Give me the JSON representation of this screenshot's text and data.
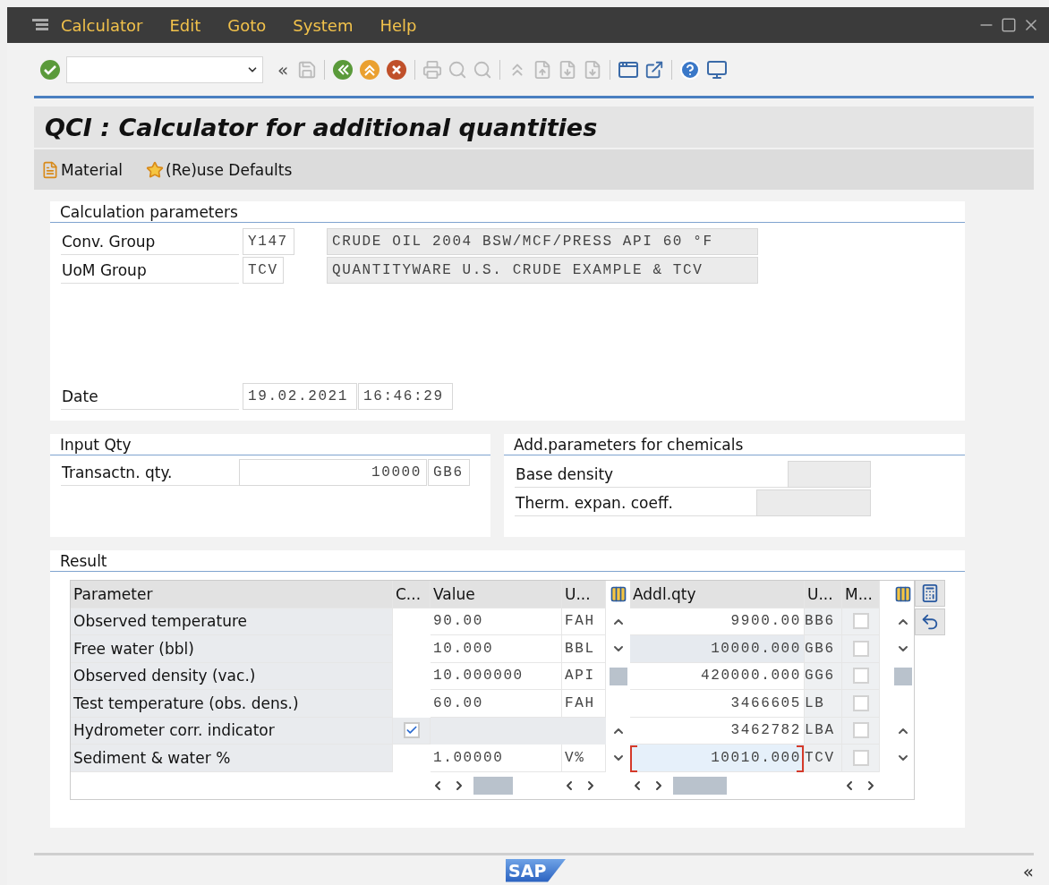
{
  "menu_bar": {
    "items": [
      "Calculator",
      "Edit",
      "Goto",
      "System",
      "Help"
    ]
  },
  "toolbar": {
    "collapse_glyph": "«"
  },
  "title": "QCI : Calculator for additional quantities",
  "app_toolbar": [
    {
      "label": "Material",
      "kind": "material"
    },
    {
      "label": "(Re)use Defaults",
      "kind": "defaults"
    }
  ],
  "calculation_parameters": {
    "title": "Calculation parameters",
    "fields": [
      {
        "label": "Conv. Group",
        "value": "Y147",
        "description": "CRUDE OIL 2004 BSW/MCF/PRESS API 60 °F"
      },
      {
        "label": "UoM Group",
        "value": "TCV",
        "description": "QUANTITYWARE U.S. CRUDE EXAMPLE & TCV"
      }
    ],
    "date": {
      "label": "Date",
      "date": "19.02.2021",
      "time": "16:46:29"
    }
  },
  "input_qty": {
    "title": "Input Qty",
    "label": "Transactn. qty.",
    "value": "10000",
    "unit": "GB6"
  },
  "chemicals": {
    "title": "Add.parameters for chemicals",
    "fields": [
      {
        "label": "Base density"
      },
      {
        "label": "Therm. expan. coeff."
      }
    ]
  },
  "result": {
    "title": "Result",
    "parameters": {
      "columns": [
        "Parameter",
        "C...",
        "Value",
        "U..."
      ],
      "rows": [
        {
          "kind": "value",
          "parameter": "Observed temperature",
          "value": "90.00",
          "unit": "FAH"
        },
        {
          "kind": "value",
          "parameter": "Free water (bbl)",
          "value": "10.000",
          "unit": "BBL"
        },
        {
          "kind": "value",
          "parameter": "Observed density (vac.)",
          "value": "10.000000",
          "unit": "API"
        },
        {
          "kind": "value",
          "parameter": "Test temperature (obs. dens.)",
          "value": "60.00",
          "unit": "FAH"
        },
        {
          "kind": "flag",
          "parameter": "Hydrometer corr. indicator",
          "checked": true
        },
        {
          "kind": "value",
          "parameter": "Sediment & water %",
          "value": "1.00000",
          "unit": "V%"
        }
      ]
    },
    "quantities": {
      "columns": [
        "Addl.qty",
        "U...",
        "M..."
      ],
      "rows": [
        {
          "qty": "9900.00",
          "unit": "BB6",
          "checked": false,
          "highlighted": false,
          "focused": false
        },
        {
          "qty": "10000.000",
          "unit": "GB6",
          "checked": false,
          "highlighted": true,
          "focused": false
        },
        {
          "qty": "420000.000",
          "unit": "GG6",
          "checked": false,
          "highlighted": false,
          "focused": false
        },
        {
          "qty": "3466605",
          "unit": "LB",
          "checked": false,
          "highlighted": false,
          "focused": false
        },
        {
          "qty": "3462782",
          "unit": "LBA",
          "checked": false,
          "highlighted": false,
          "focused": false
        },
        {
          "qty": "10010.000",
          "unit": "TCV",
          "checked": false,
          "highlighted": false,
          "focused": true
        }
      ]
    }
  },
  "footer": {
    "logo": "SAP",
    "collapse_glyph": "«"
  }
}
